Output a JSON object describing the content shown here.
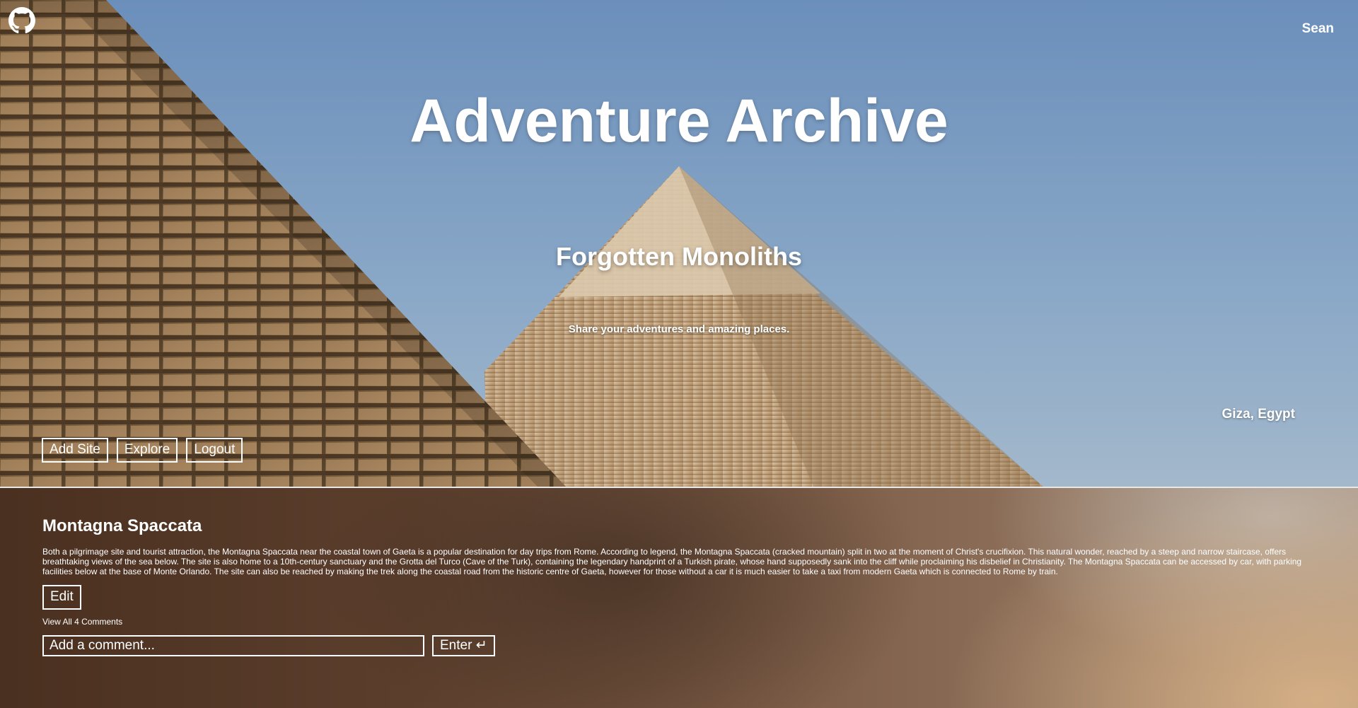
{
  "header": {
    "github_icon": "github-icon",
    "user_name": "Sean"
  },
  "hero": {
    "title": "Adventure Archive",
    "subtitle": "Forgotten Monoliths",
    "tagline": "Share your adventures and amazing places.",
    "location": "Giza, Egypt",
    "background_image": "pyramids-photo"
  },
  "nav": {
    "add_site_label": "Add Site",
    "explore_label": "Explore",
    "logout_label": "Logout"
  },
  "post": {
    "title": "Montagna Spaccata",
    "body": "Both a pilgrimage site and tourist attraction, the Montagna Spaccata near the coastal town of Gaeta is a popular destination for day trips from Rome. According to legend, the Montagna Spaccata (cracked mountain) split in two at the moment of Christ's crucifixion. This natural wonder, reached by a steep and narrow staircase, offers breathtaking views of the sea below. The site is also home to a 10th-century sanctuary and the Grotta del Turco (Cave of the Turk), containing the legendary handprint of a Turkish pirate, whose hand supposedly sank into the cliff while proclaiming his disbelief in Christianity. The Montagna Spaccata can be accessed by car, with parking facilities below at the base of Monte Orlando. The site can also be reached by making the trek along the coastal road from the historic centre of Gaeta, however for those without a car it is much easier to take a taxi from modern Gaeta which is connected to Rome by train.",
    "edit_label": "Edit",
    "view_comments_label": "View All 4 Comments",
    "comment_placeholder": "Add a comment...",
    "enter_label": "Enter ↵"
  },
  "colors": {
    "text": "#ffffff",
    "sky": "#7f9fc2",
    "stone": "#a88a68",
    "content_dark": "#4a3020",
    "content_light": "#d6b086"
  }
}
